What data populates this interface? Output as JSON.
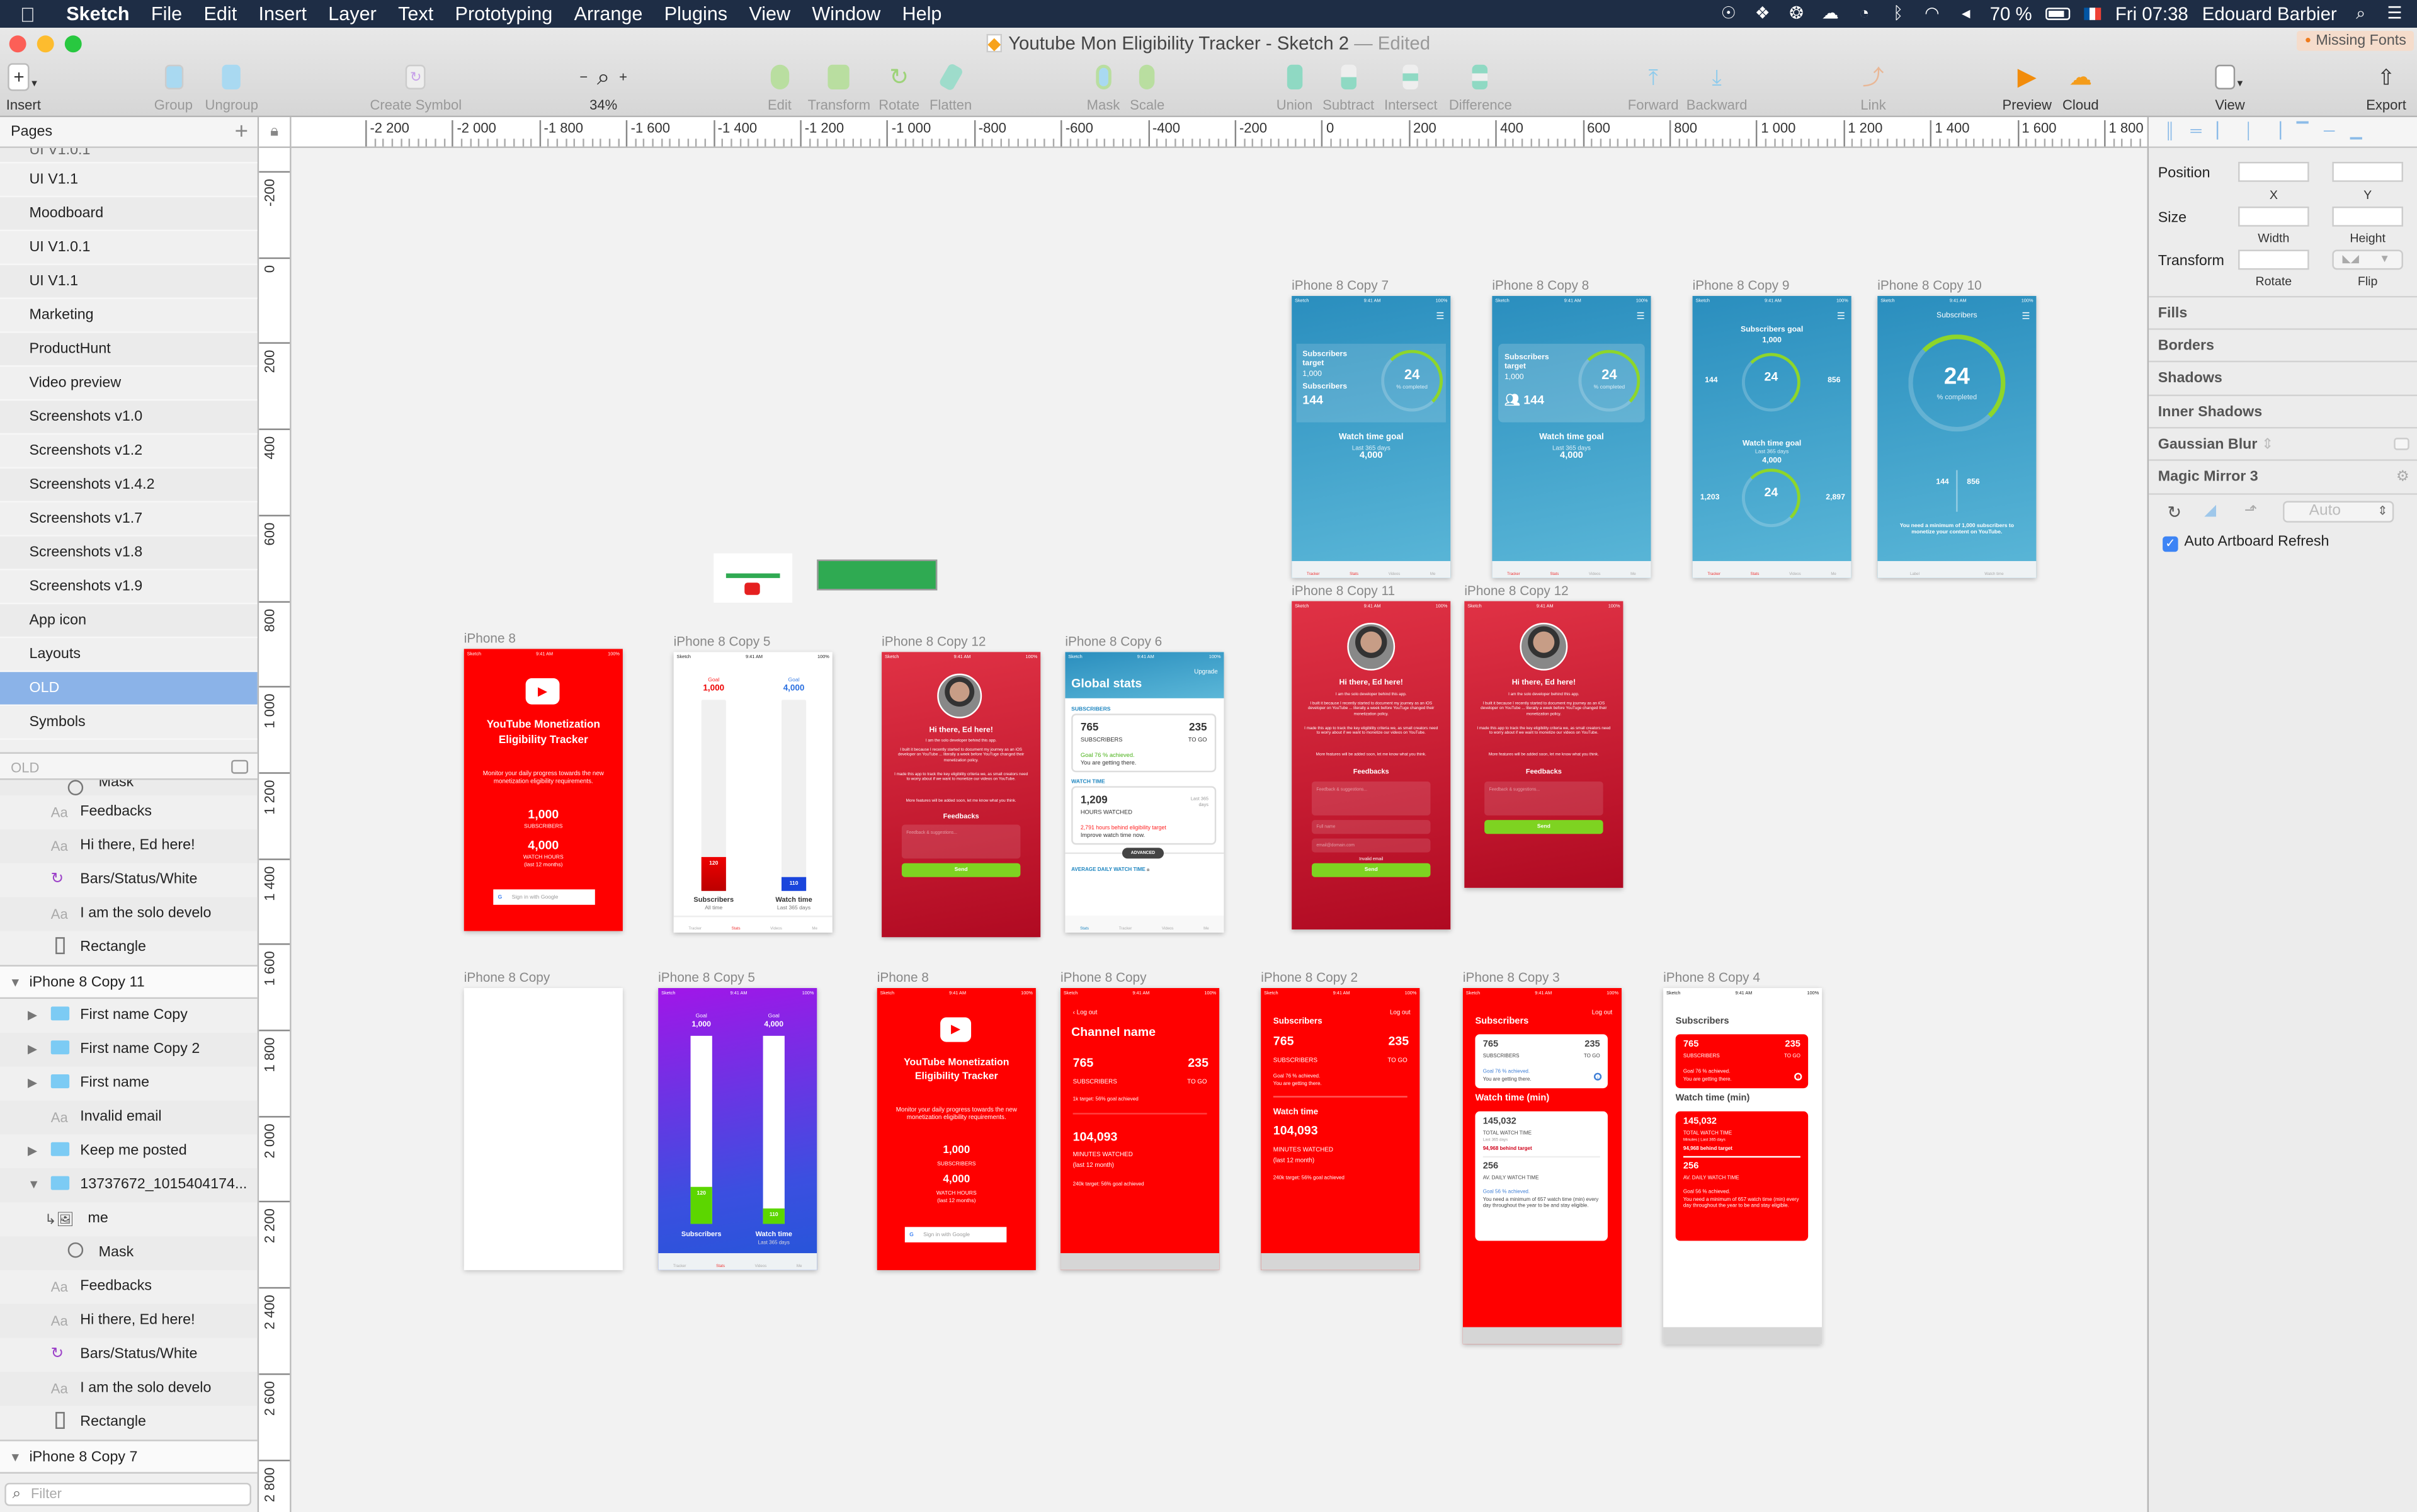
{
  "menubar": {
    "app": "Sketch",
    "items": [
      "File",
      "Edit",
      "Insert",
      "Layer",
      "Text",
      "Prototyping",
      "Arrange",
      "Plugins",
      "View",
      "Window",
      "Help"
    ],
    "battery": "70 %",
    "clock": "Fri 07:38",
    "user": "Edouard Barbier",
    "status_icons": [
      "creative-cloud-icon",
      "dropbox-icon",
      "box-icon",
      "cloud-upload-icon",
      "time-machine-icon",
      "bluetooth-icon",
      "wifi-icon",
      "volume-icon",
      "battery-icon",
      "flag-fr-icon",
      "spotlight-icon",
      "notification-center-icon"
    ]
  },
  "window": {
    "title": "Youtube Mon Eligibility Tracker - Sketch 2",
    "edited": "— Edited",
    "missing_fonts": "Missing Fonts"
  },
  "toolbar": {
    "insert": "Insert",
    "group": "Group",
    "ungroup": "Ungroup",
    "create_symbol": "Create Symbol",
    "zoom": "34%",
    "edit": "Edit",
    "transform": "Transform",
    "rotate": "Rotate",
    "flatten": "Flatten",
    "mask": "Mask",
    "scale": "Scale",
    "union": "Union",
    "subtract": "Subtract",
    "intersect": "Intersect",
    "difference": "Difference",
    "forward": "Forward",
    "backward": "Backward",
    "link": "Link",
    "preview": "Preview",
    "cloud": "Cloud",
    "view": "View",
    "export": "Export"
  },
  "rulers": {
    "horizontal": [
      "-2 200",
      "-2 000",
      "-1 800",
      "-1 600",
      "-1 400",
      "-1 200",
      "-1 000",
      "-800",
      "-600",
      "-400",
      "-200",
      "0",
      "200",
      "400",
      "600",
      "800",
      "1 000",
      "1 200",
      "1 400",
      "1 600",
      "1 800"
    ],
    "vertical": [
      "-200",
      "0",
      "200",
      "400",
      "600",
      "800",
      "1 000",
      "1 200",
      "1 400",
      "1 600",
      "1 800",
      "2 000",
      "2 200",
      "2 400",
      "2 600",
      "2 800"
    ]
  },
  "pages": {
    "header": "Pages",
    "items": [
      "UI V1.0.1",
      "UI V1.1",
      "Moodboard",
      "UI V1.0.1",
      "UI V1.1",
      "Marketing",
      "ProductHunt",
      "Video preview",
      "Screenshots v1.0",
      "Screenshots v1.2",
      "Screenshots v1.4.2",
      "Screenshots v1.7",
      "Screenshots v1.8",
      "Screenshots v1.9",
      "App icon",
      "Layouts",
      "OLD",
      "Symbols"
    ],
    "selected": "OLD"
  },
  "layers": {
    "header": "OLD",
    "filter_placeholder": "Filter",
    "items": [
      {
        "name": "Mask",
        "type": "oval",
        "indent": 2
      },
      {
        "name": "Feedbacks",
        "type": "text",
        "indent": 1
      },
      {
        "name": "Hi there, Ed here!",
        "type": "text",
        "indent": 1
      },
      {
        "name": "Bars/Status/White",
        "type": "symbol",
        "indent": 1
      },
      {
        "name": "I am the solo develo",
        "type": "text",
        "indent": 1
      },
      {
        "name": "Rectangle",
        "type": "rect",
        "indent": 1
      },
      {
        "name": "iPhone 8 Copy 11",
        "type": "artboard",
        "indent": 0
      },
      {
        "name": "First name Copy",
        "type": "group",
        "indent": 1
      },
      {
        "name": "First name Copy 2",
        "type": "group",
        "indent": 1
      },
      {
        "name": "First name",
        "type": "group",
        "indent": 1
      },
      {
        "name": "Invalid email",
        "type": "text",
        "indent": 1
      },
      {
        "name": "Keep me posted",
        "type": "group",
        "indent": 1
      },
      {
        "name": "13737672_1015404174...",
        "type": "group-open",
        "indent": 1
      },
      {
        "name": "me",
        "type": "image",
        "indent": 2
      },
      {
        "name": "Mask",
        "type": "oval",
        "indent": 2
      },
      {
        "name": "Feedbacks",
        "type": "text",
        "indent": 1
      },
      {
        "name": "Hi there, Ed here!",
        "type": "text",
        "indent": 1
      },
      {
        "name": "Bars/Status/White",
        "type": "symbol",
        "indent": 1
      },
      {
        "name": "I am the solo develo",
        "type": "text",
        "indent": 1
      },
      {
        "name": "Rectangle",
        "type": "rect",
        "indent": 1
      },
      {
        "name": "iPhone 8 Copy 7",
        "type": "artboard",
        "indent": 0
      }
    ]
  },
  "inspector": {
    "position": "Position",
    "x": "X",
    "y": "Y",
    "size": "Size",
    "width": "Width",
    "height": "Height",
    "transform": "Transform",
    "rotate": "Rotate",
    "flip": "Flip",
    "sections": [
      "Fills",
      "Borders",
      "Shadows",
      "Inner Shadows"
    ],
    "gaussian_blur": "Gaussian Blur",
    "magic_mirror": "Magic Mirror 3",
    "mm_select": "Auto",
    "auto_refresh": "Auto Artboard Refresh",
    "auto_refresh_checked": true
  },
  "status_bar": {
    "carrier": "Sketch",
    "time": "9:41 AM",
    "battery": "100%"
  },
  "tabs": {
    "tracker": "Tracker",
    "stats": "Stats",
    "videos": "Videos",
    "me": "Me",
    "label": "Label",
    "watch_time": "Watch time"
  },
  "artboards": {
    "copy7": {
      "label": "iPhone 8 Copy 7",
      "sub_target": "Subscribers target",
      "target": "1,000",
      "subs_label": "Subscribers",
      "subs": "144",
      "pct": "24",
      "pct_label": "% completed",
      "wt_goal": "Watch time goal",
      "wt_period": "Last 365 days",
      "wt_value": "4,000"
    },
    "copy8": {
      "label": "iPhone 8 Copy 8",
      "sub_target": "Subscribers target",
      "target": "1,000",
      "subs": "144",
      "pct": "24",
      "pct_label": "% completed",
      "wt_goal": "Watch time goal",
      "wt_period": "Last 365 days",
      "wt_value": "4,000"
    },
    "copy9": {
      "label": "iPhone 8 Copy 9",
      "sub_goal": "Subscribers goal",
      "sub_goal_value": "1,000",
      "subs": "144",
      "to_go": "856",
      "pct": "24",
      "pct_label": "% completed",
      "wt_goal": "Watch time goal",
      "wt_period": "Last 365 days",
      "wt_value": "4,000",
      "views": "1,203",
      "wt_to_go": "2,897",
      "pct2": "24"
    },
    "copy10": {
      "label": "iPhone 8 Copy 10",
      "title": "Subscribers",
      "pct": "24",
      "pct_label": "% completed",
      "subs": "144",
      "to_go": "856",
      "note": "You need a minimum of 1,000 subscribers to monetize your content on YouTube."
    },
    "iphone8": {
      "label": "iPhone 8",
      "title": "YouTube Monetization Eligibility Tracker",
      "desc": "Monitor your daily progress towards the new monetization eligibility requirements.",
      "subs": "1,000",
      "subs_label": "SUBSCRIBERS",
      "hours": "4,000",
      "hours_label": "WATCH HOURS",
      "hours_period": "(last 12 months)",
      "signin": "Sign in with Google"
    },
    "copy5": {
      "label": "iPhone 8 Copy 5",
      "goal_label": "Goal",
      "goal1": "1,000",
      "goal2": "4,000",
      "val1": "120",
      "val2": "110",
      "fill1": 0.12,
      "fill2": 0.0275,
      "bar1": "Subscribers",
      "bar1_sub": "All time",
      "bar2": "Watch time",
      "bar2_sub": "Last 365 days"
    },
    "copy12a": {
      "label": "iPhone 8 Copy 12",
      "greeting": "Hi there, Ed here!",
      "p1": "I am the solo developer behind this app.",
      "p2": "I built it because I recently started to document my journey as an iOS developer on YouTube ... literally a week before YouTuge changed their monetization policy.",
      "p3": "I made this app to track the key eligibility criteria we, as small creators need to worry about if we want to monetize our videos on YouTube.",
      "p4": "More features will be added soon, let me know what you think.",
      "feedbacks": "Feedbacks",
      "placeholder": "Feedback & suggestions...",
      "send": "Send"
    },
    "copy6": {
      "label": "iPhone 8 Copy 6",
      "upgrade": "Upgrade",
      "title": "Global stats",
      "sec1": "SUBSCRIBERS",
      "subs": "765",
      "subs_label": "SUBSCRIBERS",
      "to_go": "235",
      "to_go_label": "TO GO",
      "goal": "Goal 76 % achieved.",
      "goal_sub": "You are getting there.",
      "sec2": "WATCH TIME",
      "hours": "1,209",
      "hours_label": "HOURS WATCHED",
      "period": "Last 365 days",
      "behind": "2,791 hours behind eligibility target",
      "improve": "Improve watch time now.",
      "advanced": "ADVANCED",
      "sec3": "AVERAGE DAILY WATCH TIME"
    },
    "copy11": {
      "label": "iPhone 8 Copy 11",
      "full_name": "Full name",
      "email": "email@domain.com",
      "invalid": "Invalid email"
    },
    "copy12b": {
      "label": "iPhone 8 Copy 12"
    },
    "copy": {
      "label": "iPhone 8 Copy"
    },
    "copy5b": {
      "label": "iPhone 8 Copy 5",
      "bar2_sub": "Last 365 days"
    },
    "iphone8b": {
      "label": "iPhone 8"
    },
    "copy_ch": {
      "label": "iPhone 8 Copy",
      "logout": "Log out",
      "channel": "Channel name",
      "subs": "765",
      "subs_label": "SUBSCRIBERS",
      "to_go": "235",
      "to_go_label": "TO GO",
      "target1": "1k target: 56% goal achieved",
      "minutes": "104,093",
      "minutes_label": "MINUTES WATCHED",
      "minutes_period": "(last 12 month)",
      "target2": "240k target: 56% goal achieved"
    },
    "copy2": {
      "label": "iPhone 8 Copy 2",
      "logout": "Log out",
      "subs_title": "Subscribers",
      "subs": "765",
      "to_go": "235",
      "goal": "Goal 76 % achieved.",
      "goal_sub": "You are getting there.",
      "wt_title": "Watch time",
      "minutes": "104,093",
      "target2": "240k target: 56% goal achieved"
    },
    "copy3": {
      "label": "iPhone 8 Copy 3",
      "logout": "Log out",
      "subs_title": "Subscribers",
      "subs": "765",
      "to_go": "235",
      "goal": "Goal 76 % achieved.",
      "goal_sub": "You are getting there.",
      "wt_title": "Watch time (min)",
      "total": "145,032",
      "total_label": "TOTAL WATCH TIME",
      "period": "Last 365 days",
      "behind": "94,968 behind target",
      "daily": "256",
      "daily_label": "AV. DAILY WATCH TIME",
      "goal2": "Goal 56 % achieved.",
      "need": "You need a minimum of 657 watch time (min) every day throughout the year to be and stay eligible."
    },
    "copy4": {
      "label": "iPhone 8 Copy 4",
      "period": "Minutes | Last 365 days"
    }
  },
  "colors": {
    "youtube_red": "#ff0000",
    "green": "#7ed321",
    "blue": "#2a8ebe",
    "crimson": "#c4142c",
    "purple": "#a116e8",
    "selection": "#8bb3e8"
  }
}
